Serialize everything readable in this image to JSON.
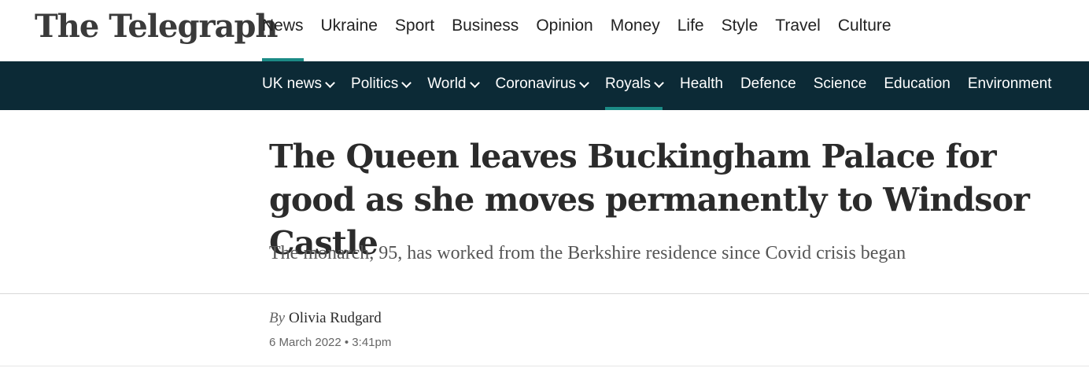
{
  "header": {
    "logo": "The Telegraph",
    "primary_nav": [
      {
        "label": "News",
        "active": true
      },
      {
        "label": "Ukraine",
        "active": false
      },
      {
        "label": "Sport",
        "active": false
      },
      {
        "label": "Business",
        "active": false
      },
      {
        "label": "Opinion",
        "active": false
      },
      {
        "label": "Money",
        "active": false
      },
      {
        "label": "Life",
        "active": false
      },
      {
        "label": "Style",
        "active": false
      },
      {
        "label": "Travel",
        "active": false
      },
      {
        "label": "Culture",
        "active": false
      }
    ],
    "secondary_nav": [
      {
        "label": "UK news",
        "has_dropdown": true,
        "active": false
      },
      {
        "label": "Politics",
        "has_dropdown": true,
        "active": false
      },
      {
        "label": "World",
        "has_dropdown": true,
        "active": false
      },
      {
        "label": "Coronavirus",
        "has_dropdown": true,
        "active": false
      },
      {
        "label": "Royals",
        "has_dropdown": true,
        "active": true
      },
      {
        "label": "Health",
        "has_dropdown": false,
        "active": false
      },
      {
        "label": "Defence",
        "has_dropdown": false,
        "active": false
      },
      {
        "label": "Science",
        "has_dropdown": false,
        "active": false
      },
      {
        "label": "Education",
        "has_dropdown": false,
        "active": false
      },
      {
        "label": "Environment",
        "has_dropdown": false,
        "active": false
      }
    ]
  },
  "article": {
    "headline": "The Queen leaves Buckingham Palace for good as she moves permanently to Windsor Castle",
    "standfirst": "The monarch, 95, has worked from the Berkshire residence since Covid crisis began",
    "byline_prefix": "By",
    "author": "Olivia Rudgard",
    "date": "6 March 2022 • 3:41pm"
  },
  "colors": {
    "secondary_nav_bg": "#0c2a36",
    "accent": "#1c8b86",
    "headline": "#2b2b2b"
  }
}
